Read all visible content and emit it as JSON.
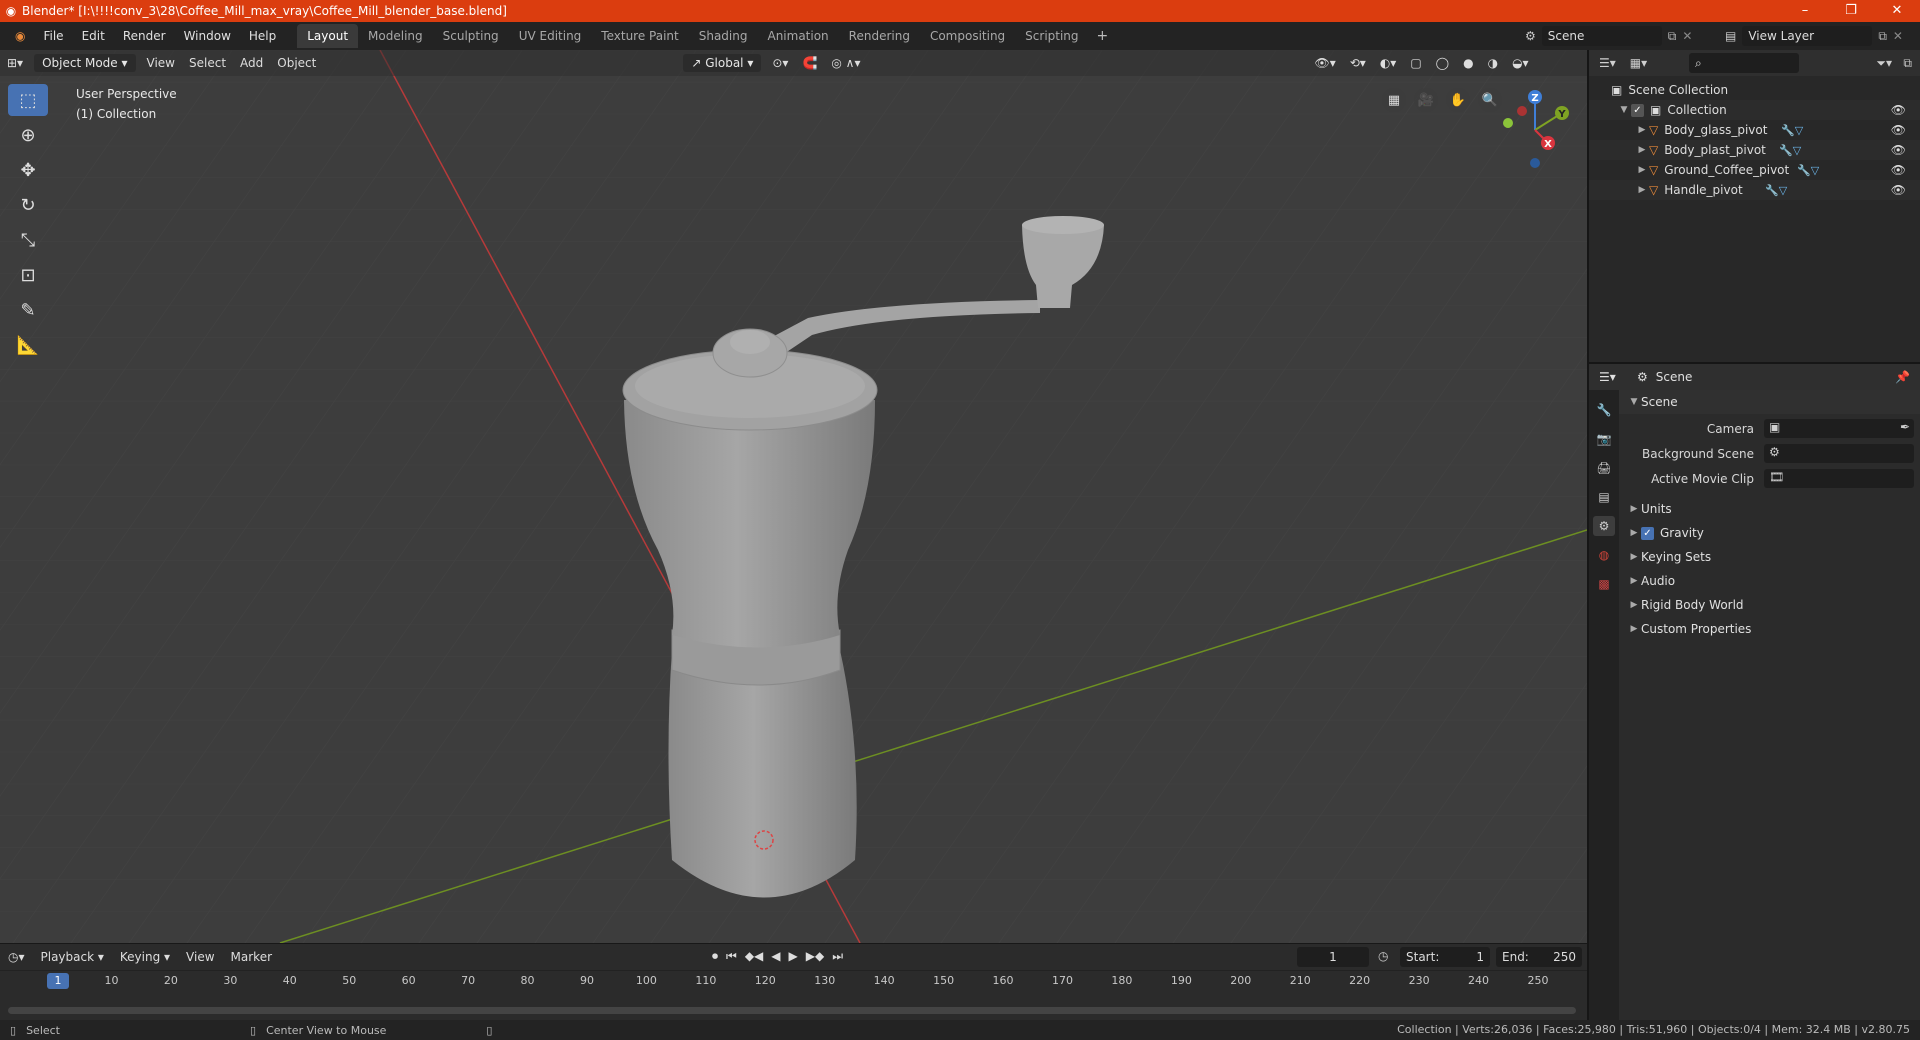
{
  "window": {
    "title": "Blender* [I:\\!!!!conv_3\\28\\Coffee_Mill_max_vray\\Coffee_Mill_blender_base.blend]",
    "controls": [
      "–",
      "❐",
      "✕"
    ]
  },
  "menu": [
    "File",
    "Edit",
    "Render",
    "Window",
    "Help"
  ],
  "workspaces": [
    {
      "label": "Layout",
      "active": true
    },
    {
      "label": "Modeling"
    },
    {
      "label": "Sculpting"
    },
    {
      "label": "UV Editing"
    },
    {
      "label": "Texture Paint"
    },
    {
      "label": "Shading"
    },
    {
      "label": "Animation"
    },
    {
      "label": "Rendering"
    },
    {
      "label": "Compositing"
    },
    {
      "label": "Scripting"
    }
  ],
  "scene_selector": {
    "value": "Scene"
  },
  "view_layer_selector": {
    "value": "View Layer"
  },
  "viewport": {
    "mode": "Object Mode",
    "menus": [
      "View",
      "Select",
      "Add",
      "Object"
    ],
    "transform_orientation": "Global",
    "info_line1": "User Perspective",
    "info_line2": "(1) Collection",
    "gizmo_axes": {
      "x": "X",
      "y": "Y",
      "z": "Z"
    }
  },
  "outliner": {
    "root": "Scene Collection",
    "collection": "Collection",
    "objects": [
      {
        "name": "Body_glass_pivot"
      },
      {
        "name": "Body_plast_pivot"
      },
      {
        "name": "Ground_Coffee_pivot"
      },
      {
        "name": "Handle_pivot"
      }
    ]
  },
  "properties": {
    "header": "Scene",
    "panel": "Scene",
    "fields": [
      {
        "label": "Camera"
      },
      {
        "label": "Background Scene"
      },
      {
        "label": "Active Movie Clip"
      }
    ],
    "subpanels": [
      "Units",
      "Gravity",
      "Keying Sets",
      "Audio",
      "Rigid Body World",
      "Custom Properties"
    ],
    "gravity_enabled": true
  },
  "timeline": {
    "menus": [
      "Playback",
      "Keying",
      "View",
      "Marker"
    ],
    "current_frame": "1",
    "start_label": "Start:",
    "start": "1",
    "end_label": "End:",
    "end": "250",
    "ticks": [
      "1",
      "10",
      "20",
      "30",
      "40",
      "50",
      "60",
      "70",
      "80",
      "90",
      "100",
      "110",
      "120",
      "130",
      "140",
      "150",
      "160",
      "170",
      "180",
      "190",
      "200",
      "210",
      "220",
      "230",
      "240",
      "250"
    ]
  },
  "statusbar": {
    "left": "Select",
    "middle": "Center View to Mouse",
    "stats": "Collection | Verts:26,036 | Faces:25,980 | Tris:51,960 | Objects:0/4 | Mem: 32.4 MB | v2.80.75"
  },
  "colors": {
    "titlebar": "#db3d0f",
    "accent": "#4772b3",
    "viewport_bg": "#3d3d3d",
    "axis_x": "#d9353f",
    "axis_y": "#7fa323",
    "object_orange": "#e8893a"
  }
}
